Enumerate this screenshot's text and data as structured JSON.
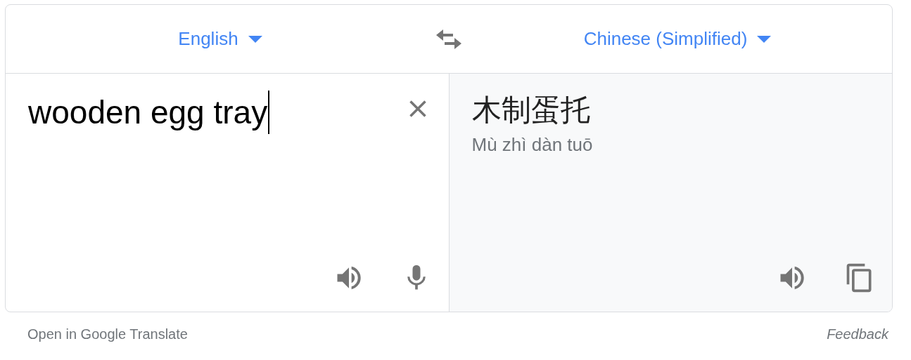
{
  "languages": {
    "source": {
      "label": "English"
    },
    "target": {
      "label": "Chinese (Simplified)"
    }
  },
  "source_text": {
    "value": "wooden egg tray"
  },
  "translation": {
    "text": "木制蛋托",
    "romanization": "Mù zhì dàn tuō"
  },
  "footer": {
    "open_link": "Open in Google Translate",
    "feedback": "Feedback"
  }
}
